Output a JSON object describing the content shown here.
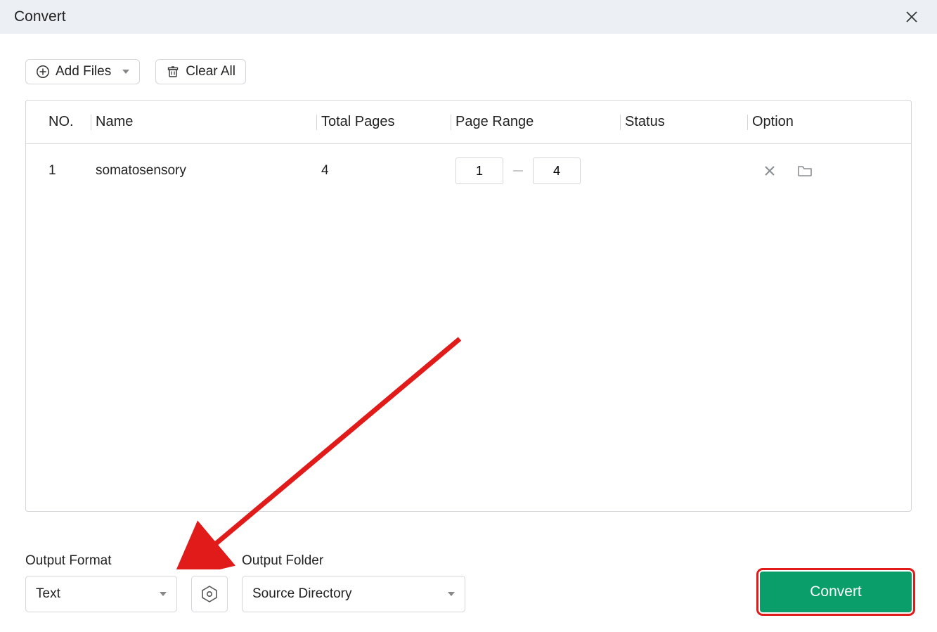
{
  "window": {
    "title": "Convert"
  },
  "toolbar": {
    "add_files_label": "Add Files",
    "clear_all_label": "Clear All"
  },
  "table": {
    "headers": {
      "no": "NO.",
      "name": "Name",
      "total_pages": "Total Pages",
      "page_range": "Page Range",
      "status": "Status",
      "option": "Option"
    },
    "rows": [
      {
        "no": "1",
        "name": "somatosensory",
        "total_pages": "4",
        "range_from": "1",
        "range_to": "4",
        "status": ""
      }
    ]
  },
  "output": {
    "format_label": "Output Format",
    "format_value": "Text",
    "folder_label": "Output Folder",
    "folder_value": "Source Directory"
  },
  "actions": {
    "convert_label": "Convert"
  },
  "icons": {
    "plus": "plus-circle-icon",
    "trash": "trash-icon",
    "close": "close-icon",
    "row_remove": "x-icon",
    "row_folder": "folder-icon",
    "settings": "hexagon-settings-icon",
    "chevron": "chevron-down-icon"
  },
  "colors": {
    "accent_green": "#0a9e6a",
    "annotation_red": "#e11a1a",
    "border": "#d4d6da",
    "titlebar_bg": "#eceff3"
  }
}
